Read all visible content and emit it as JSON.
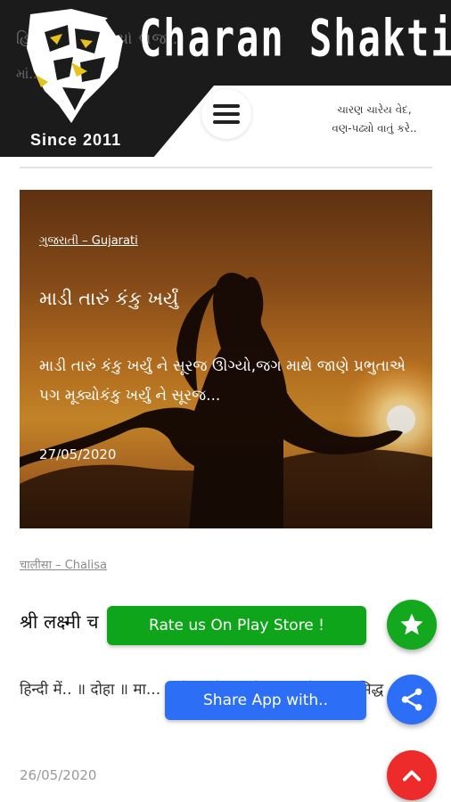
{
  "header": {
    "brand": "Charan Shakti",
    "since": "Since 2011",
    "tagline_line1": "ચારણ ચારેય વેદ,",
    "tagline_line2": "વણ-પઢ્યો વાતું કરે..",
    "ghost_line1": "હિ...માં જા...ણ્યો ભજ...",
    "ghost_line2": "માં... ભા...માં..."
  },
  "featured": {
    "category": "ગુજરાતી – Gujarati",
    "title": "માડી તારું કંકુ ખર્યું",
    "excerpt": "માડી તારું કંકુ ખર્યું ને સૂરજ ઊગ્યો,જગ માથે જાણે પ્રભુતાએ પગ મૂક્યોકંકુ ખર્યું ને સૂરજ...",
    "date": "27/05/2020"
  },
  "post2": {
    "category": "चालीसा – Chalisa",
    "title": "श्री लक्ष्मी च",
    "title_tail": "ha",
    "excerpt": "हिन्दी में.. ॥ दोहा ॥ मा... ...ये। ...रि...य में वास।मनोकामना सिद्ध ...रि...",
    "date": "26/05/2020"
  },
  "actions": {
    "rate_label": "Rate us On Play Store !",
    "share_label": "Share App with.."
  },
  "icons": {
    "menu": "hamburger-menu-icon",
    "rate": "star-icon",
    "share": "share-icon",
    "top": "chevron-up-icon"
  },
  "colors": {
    "header_bg": "#1b1b1b",
    "rate_green": "#0fa51a",
    "share_blue": "#2d6ef6",
    "top_red": "#ee2b2b"
  }
}
